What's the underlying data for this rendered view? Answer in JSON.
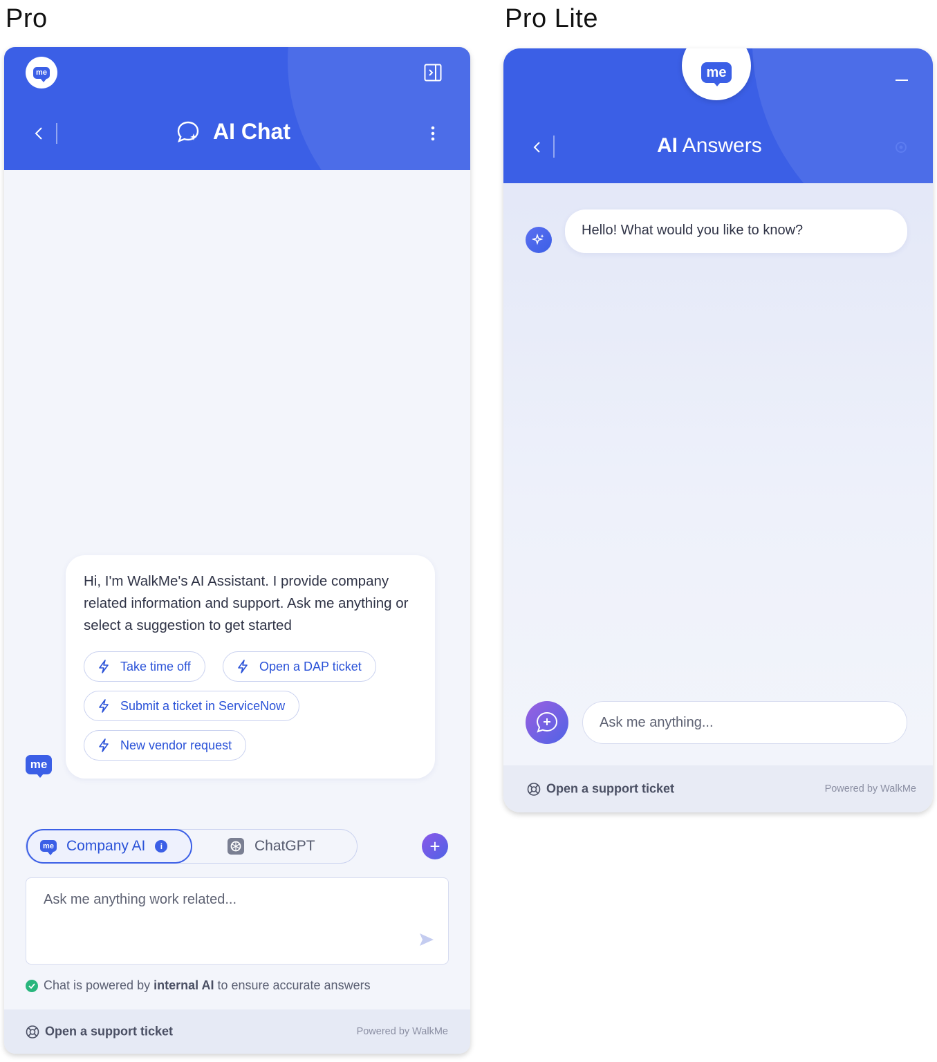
{
  "labels": {
    "pro": "Pro",
    "pro_lite": "Pro Lite"
  },
  "colors": {
    "brand_blue": "#3b5fe6",
    "chip_text": "#2a52d8",
    "success_green": "#29b67d",
    "gradient_purple": "#8a57e8"
  },
  "pro": {
    "header": {
      "logo_text": "me",
      "title": "AI Chat",
      "icons": [
        "me-logo",
        "sidebar-toggle-icon",
        "back-chevron-icon",
        "ai-chat-icon",
        "kebab-menu-icon"
      ]
    },
    "greeting": "Hi, I'm WalkMe's AI Assistant. I provide company related information and support. Ask me anything or select a suggestion to get started",
    "suggestions": [
      "Take time off",
      "Open a DAP ticket",
      "Submit a ticket in ServiceNow",
      "New vendor request"
    ],
    "avatar_text": "me",
    "toggle": {
      "company_label": "Company AI",
      "company_badge": "me",
      "chatgpt_label": "ChatGPT"
    },
    "plus_label": "+",
    "input_placeholder": "Ask me anything work related...",
    "note": {
      "prefix": "Chat is powered by ",
      "bold": "internal AI",
      "suffix": " to ensure accurate answers"
    },
    "footer": {
      "support": "Open a support ticket",
      "powered": "Powered by WalkMe"
    }
  },
  "lite": {
    "header": {
      "logo_text": "me",
      "title_bold": "AI",
      "title_rest": " Answers",
      "icons": [
        "minimize-icon",
        "back-chevron-icon",
        "settings-icon"
      ]
    },
    "greeting": "Hello! What would you like to know?",
    "input_placeholder": "Ask me anything...",
    "footer": {
      "support": "Open a support ticket",
      "powered": "Powered by WalkMe"
    }
  }
}
